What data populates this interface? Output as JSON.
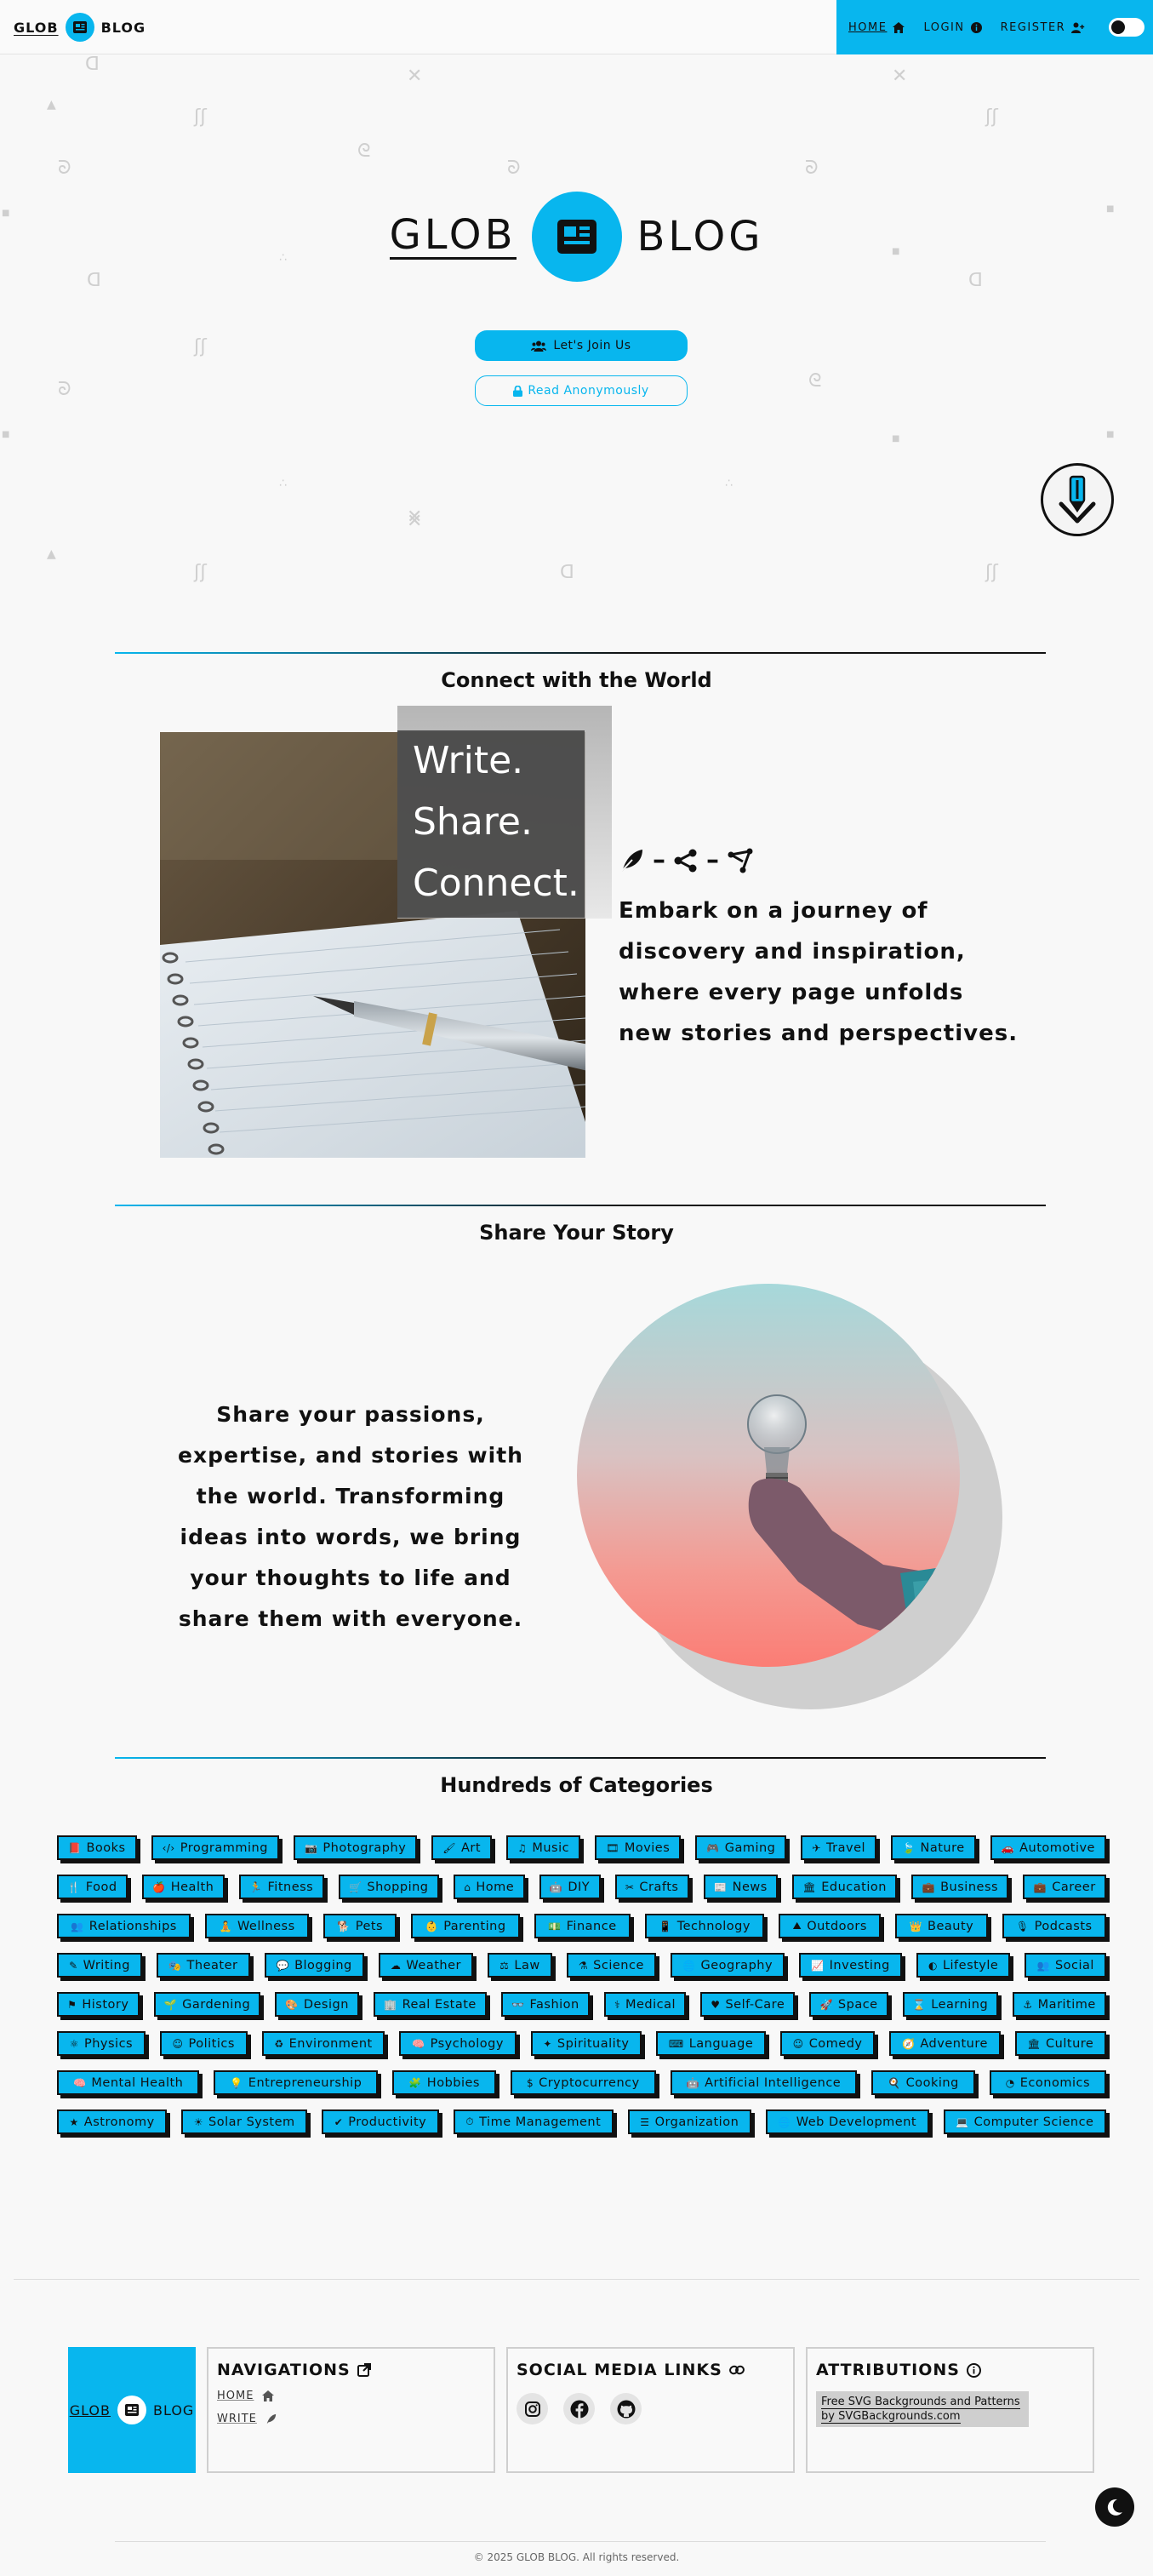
{
  "brand": {
    "word1": "GLOB",
    "word2": "BLOG"
  },
  "nav": {
    "home": "HOME",
    "login": "LOGIN",
    "register": "REGISTER"
  },
  "hero": {
    "title_word1": "GLOB",
    "title_word2": "BLOG",
    "join_label": "Let's Join Us",
    "read_label": "Read Anonymously"
  },
  "connect": {
    "heading": "Connect with the World",
    "overlay_lines": [
      "Write.",
      "Share.",
      "Connect."
    ],
    "text": "Embark on a journey of discovery and inspiration, where every page unfolds new stories and perspectives."
  },
  "share": {
    "heading": "Share Your Story",
    "text": "Share your passions, expertise, and stories with the world. Transforming ideas into words, we bring your thoughts to life and share them with everyone."
  },
  "categories": {
    "heading": "Hundreds of Categories",
    "items": [
      {
        "label": "Books",
        "icon": "📕"
      },
      {
        "label": "Programming",
        "icon": "‹/›"
      },
      {
        "label": "Photography",
        "icon": "📷"
      },
      {
        "label": "Art",
        "icon": "🖌"
      },
      {
        "label": "Music",
        "icon": "♫"
      },
      {
        "label": "Movies",
        "icon": "🎞"
      },
      {
        "label": "Gaming",
        "icon": "🎮"
      },
      {
        "label": "Travel",
        "icon": "✈"
      },
      {
        "label": "Nature",
        "icon": "🍃"
      },
      {
        "label": "Automotive",
        "icon": "🚗"
      },
      {
        "label": "Food",
        "icon": "🍴"
      },
      {
        "label": "Health",
        "icon": "🍎"
      },
      {
        "label": "Fitness",
        "icon": "🏃"
      },
      {
        "label": "Shopping",
        "icon": "🛒"
      },
      {
        "label": "Home",
        "icon": "⌂"
      },
      {
        "label": "DIY",
        "icon": "🤖"
      },
      {
        "label": "Crafts",
        "icon": "✂"
      },
      {
        "label": "News",
        "icon": "📰"
      },
      {
        "label": "Education",
        "icon": "🏛"
      },
      {
        "label": "Business",
        "icon": "💼"
      },
      {
        "label": "Career",
        "icon": "💼"
      },
      {
        "label": "Relationships",
        "icon": "👥"
      },
      {
        "label": "Wellness",
        "icon": "🧘"
      },
      {
        "label": "Pets",
        "icon": "🐕"
      },
      {
        "label": "Parenting",
        "icon": "👶"
      },
      {
        "label": "Finance",
        "icon": "💵"
      },
      {
        "label": "Technology",
        "icon": "📱"
      },
      {
        "label": "Outdoors",
        "icon": "⛰"
      },
      {
        "label": "Beauty",
        "icon": "👑"
      },
      {
        "label": "Podcasts",
        "icon": "🎙"
      },
      {
        "label": "Writing",
        "icon": "✎"
      },
      {
        "label": "Theater",
        "icon": "🎭"
      },
      {
        "label": "Blogging",
        "icon": "💬"
      },
      {
        "label": "Weather",
        "icon": "☁"
      },
      {
        "label": "Law",
        "icon": "⚖"
      },
      {
        "label": "Science",
        "icon": "⚗"
      },
      {
        "label": "Geography",
        "icon": "🌐"
      },
      {
        "label": "Investing",
        "icon": "📈"
      },
      {
        "label": "Lifestyle",
        "icon": "◐"
      },
      {
        "label": "Social",
        "icon": "👥"
      },
      {
        "label": "History",
        "icon": "⚑"
      },
      {
        "label": "Gardening",
        "icon": "🌱"
      },
      {
        "label": "Design",
        "icon": "🎨"
      },
      {
        "label": "Real Estate",
        "icon": "🏢"
      },
      {
        "label": "Fashion",
        "icon": "👓"
      },
      {
        "label": "Medical",
        "icon": "⚕"
      },
      {
        "label": "Self-Care",
        "icon": "♥"
      },
      {
        "label": "Space",
        "icon": "🚀"
      },
      {
        "label": "Learning",
        "icon": "⌛"
      },
      {
        "label": "Maritime",
        "icon": "⚓"
      },
      {
        "label": "Physics",
        "icon": "⚛"
      },
      {
        "label": "Politics",
        "icon": "☺"
      },
      {
        "label": "Environment",
        "icon": "♻"
      },
      {
        "label": "Psychology",
        "icon": "🧠"
      },
      {
        "label": "Spirituality",
        "icon": "✦"
      },
      {
        "label": "Language",
        "icon": "⌨"
      },
      {
        "label": "Comedy",
        "icon": "☺"
      },
      {
        "label": "Adventure",
        "icon": "🧭"
      },
      {
        "label": "Culture",
        "icon": "🏛"
      },
      {
        "label": "Mental Health",
        "icon": "🧠"
      },
      {
        "label": "Entrepreneurship",
        "icon": "💡"
      },
      {
        "label": "Hobbies",
        "icon": "🧩"
      },
      {
        "label": "Cryptocurrency",
        "icon": "$"
      },
      {
        "label": "Artificial Intelligence",
        "icon": "🤖"
      },
      {
        "label": "Cooking",
        "icon": "🍳"
      },
      {
        "label": "Economics",
        "icon": "◔"
      },
      {
        "label": "Astronomy",
        "icon": "★"
      },
      {
        "label": "Solar System",
        "icon": "☀"
      },
      {
        "label": "Productivity",
        "icon": "✔"
      },
      {
        "label": "Time Management",
        "icon": "⏱"
      },
      {
        "label": "Organization",
        "icon": "☰"
      },
      {
        "label": "Web Development",
        "icon": "🌐"
      },
      {
        "label": "Computer Science",
        "icon": "💻"
      }
    ]
  },
  "footer": {
    "logo_word1": "GLOB",
    "logo_word2": "BLOG",
    "nav_title": "NAVIGATIONS",
    "nav_home": "HOME",
    "nav_write": "WRITE",
    "social_title": "SOCIAL MEDIA LINKS",
    "attr_title": "ATTRIBUTIONS",
    "attr_text": "Free SVG Backgrounds and Patterns by SVGBackgrounds.com",
    "copyright": "© 2025 GLOB BLOG. All rights reserved."
  },
  "colors": {
    "accent": "#08b6ee",
    "text": "#111111",
    "background": "#f8f8f8"
  }
}
